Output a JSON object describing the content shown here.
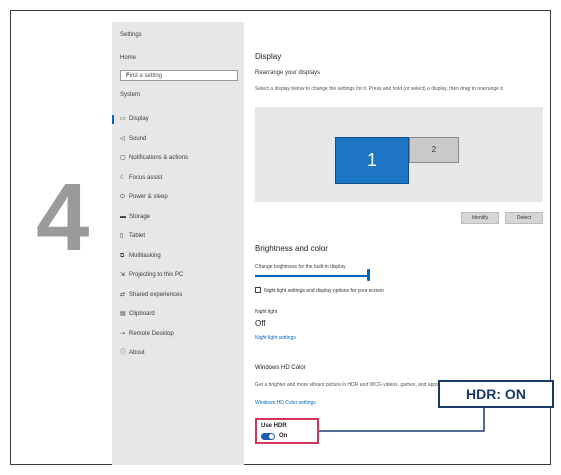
{
  "step": {
    "number": "4"
  },
  "sidebar": {
    "title": "Settings",
    "home": "Home",
    "search_placeholder": "Find a setting",
    "category": "System",
    "items": [
      {
        "icon": "monitor-icon",
        "glyph": "▭",
        "label": "Display",
        "active": true
      },
      {
        "icon": "speaker-icon",
        "glyph": "◁",
        "label": "Sound"
      },
      {
        "icon": "notifications-icon",
        "glyph": "▢",
        "label": "Notifications & actions"
      },
      {
        "icon": "focus-assist-icon",
        "glyph": "☾",
        "label": "Focus assist"
      },
      {
        "icon": "power-icon",
        "glyph": "⏻",
        "label": "Power & sleep"
      },
      {
        "icon": "storage-icon",
        "glyph": "▬",
        "label": "Storage"
      },
      {
        "icon": "tablet-icon",
        "glyph": "▯",
        "label": "Tablet"
      },
      {
        "icon": "multitasking-icon",
        "glyph": "⧉",
        "label": "Multitasking"
      },
      {
        "icon": "projecting-icon",
        "glyph": "⇲",
        "label": "Projecting to this PC"
      },
      {
        "icon": "shared-experiences-icon",
        "glyph": "⇄",
        "label": "Shared experiences"
      },
      {
        "icon": "clipboard-icon",
        "glyph": "▤",
        "label": "Clipboard"
      },
      {
        "icon": "remote-desktop-icon",
        "glyph": "⇢",
        "label": "Remote Desktop"
      },
      {
        "icon": "about-icon",
        "glyph": "ⓘ",
        "label": "About"
      }
    ]
  },
  "main": {
    "title": "Display",
    "section_sub": "Rearrange your displays",
    "section_desc": "Select a display below to change the settings for it. Press and hold (or select) a display, then drag to rearrange it.",
    "preview": {
      "monitor1": "1",
      "monitor2": "2"
    },
    "identify_button": "Identify",
    "detect_button": "Detect",
    "multiple_heading": "Brightness and color",
    "brightness_label": "Change brightness for the built-in display",
    "brightness_level": 0.97,
    "night_light_text": "Night light settings and display options for your screen",
    "night_light_label": "Night light",
    "night_light_toggle": "Off",
    "night_light_link": "Night light settings",
    "hdr_heading": "Windows HD Color",
    "hdr_desc": "Get a brighter and more vibrant picture in HDR and WCG videos, games, and apps.",
    "hdr_link": "Windows HD Color settings",
    "use_hdr_label": "Use HDR",
    "use_hdr_state": "On"
  },
  "callout": {
    "text": "HDR: ON"
  },
  "colors": {
    "accent": "#0067c0",
    "highlight": "#d4345a",
    "callout": "#1a3a6b",
    "monitor": "#1c75c3"
  }
}
